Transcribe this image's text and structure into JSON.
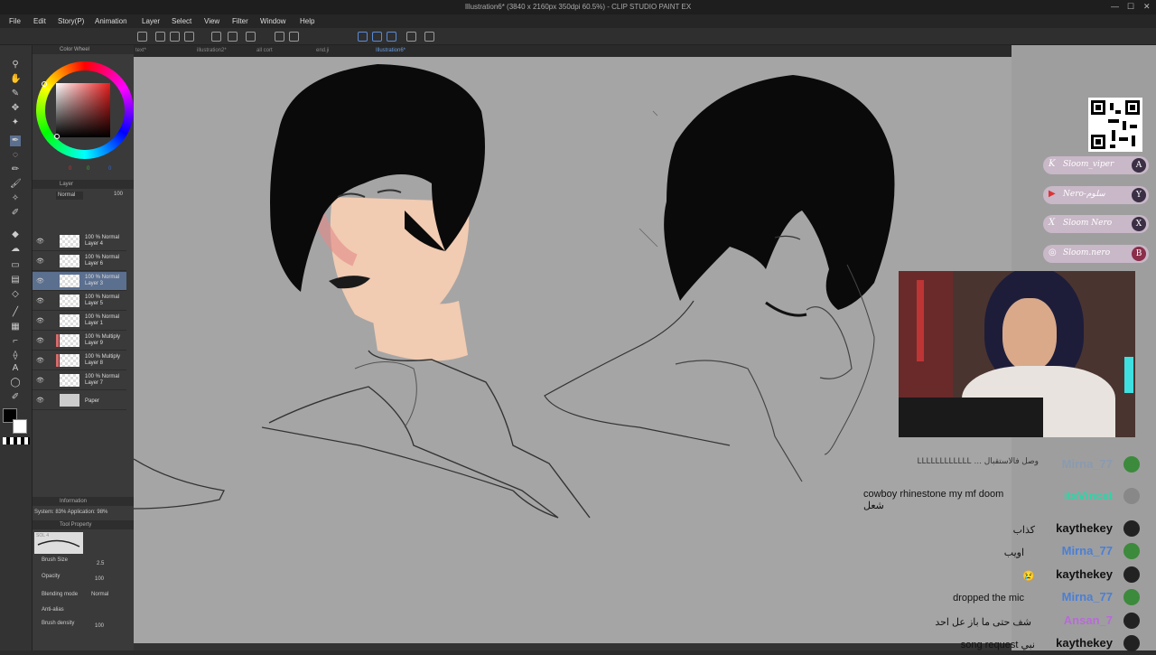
{
  "window": {
    "title": "Illustration6* (3840 x 2160px 350dpi 60.5%) - CLIP STUDIO PAINT EX",
    "controls": [
      "—",
      "☐",
      "✕"
    ]
  },
  "menu": [
    "File",
    "Edit",
    "Story(P)",
    "Animation",
    "Layer",
    "Select",
    "View",
    "Filter",
    "Window",
    "Help"
  ],
  "tabs": [
    "text*",
    "illustration2*",
    "all cort",
    "end.ji",
    "Illustration6*"
  ],
  "panels": {
    "color": "Color Wheel",
    "color_values": [
      "0",
      "0",
      "0"
    ],
    "layer_panel": "Layer",
    "blend_mode": "Normal",
    "layer_opacity": "100",
    "information": "Information",
    "system_info": "System: 83%  Application: 98%",
    "tool_property": "Tool Property",
    "brush_name": "SOL 4"
  },
  "layers": [
    {
      "mode": "100 % Normal",
      "name": "Layer 4"
    },
    {
      "mode": "100 % Normal",
      "name": "Layer 6"
    },
    {
      "mode": "100 % Normal",
      "name": "Layer 3"
    },
    {
      "mode": "100 % Normal",
      "name": "Layer 5"
    },
    {
      "mode": "100 % Normal",
      "name": "Layer 1"
    },
    {
      "mode": "100 % Multiply",
      "name": "Layer 9"
    },
    {
      "mode": "100 % Multiply",
      "name": "Layer 8"
    },
    {
      "mode": "100 % Normal",
      "name": "Layer 7"
    },
    {
      "mode": "",
      "name": "Paper"
    }
  ],
  "tool_props": [
    {
      "label": "Brush Size",
      "value": "2.5"
    },
    {
      "label": "Opacity",
      "value": "100"
    },
    {
      "label": "Blending mode",
      "value": "Normal"
    },
    {
      "label": "Anti-alias",
      "value": ""
    },
    {
      "label": "Brush density",
      "value": "100"
    }
  ],
  "socials": [
    {
      "icon": "K",
      "handle": "Sloom_viper",
      "badge": "A"
    },
    {
      "icon": "▶",
      "handle": "Nero-سلوم",
      "badge": "Y"
    },
    {
      "icon": "X",
      "handle": "Sloom Nero",
      "badge": "X"
    },
    {
      "icon": "◎",
      "handle": "Sloom.nero",
      "badge": "B"
    }
  ],
  "chat": [
    {
      "user": "Mirna_77",
      "text": "وصل فالاستقبال … ‫LLLLLLLLLLLL‬",
      "user_color": "#8a9ab0"
    },
    {
      "user": "itsVincet",
      "text": "cowboy rhinestone my mf doom شعل",
      "user_color": "#2fd4a8"
    },
    {
      "user": "kaythekey",
      "text": "كذاب",
      "user_color": "#111111"
    },
    {
      "user": "Mirna_77",
      "text": "اويب",
      "user_color": "#4a7fd6"
    },
    {
      "user": "kaythekey",
      "text": "😢",
      "user_color": "#111111"
    },
    {
      "user": "Mirna_77",
      "text": "dropped the mic",
      "user_color": "#4a7fd6"
    },
    {
      "user": "Ansan_7",
      "text": "شف حتى ما باز عل احد",
      "user_color": "#b86ad8"
    },
    {
      "user": "kaythekey",
      "text": "song request نبي",
      "user_color": "#111111"
    }
  ]
}
